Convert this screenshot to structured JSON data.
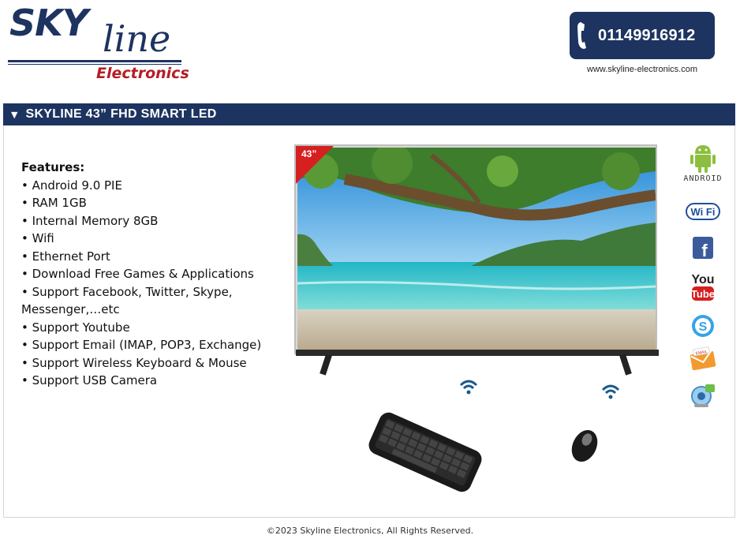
{
  "header": {
    "logo": {
      "word1": "SKY",
      "word2": "line",
      "tagline": "Electronics"
    },
    "phone": "01149916912",
    "website": "www.skyline-electronics.com"
  },
  "product": {
    "title_arrow": "▼",
    "title": "SKYLINE 43” FHD SMART LED",
    "badge": "43”",
    "features_title": "Features:",
    "features": [
      "• Android 9.0 PIE",
      "• RAM 1GB",
      "• Internal Memory 8GB",
      "• Wifi",
      "• Ethernet Port",
      "• Download Free Games & Applications",
      "• Support Facebook, Twitter, Skype, Messenger,…etc",
      "• Support Youtube",
      "• Support Email (IMAP, POP3, Exchange)",
      "• Support Wireless Keyboard & Mouse",
      "• Support USB Camera"
    ]
  },
  "side_icons": {
    "android_label": "ANDROID",
    "wifi_label": "Wi Fi",
    "facebook_label": "f",
    "youtube_top": "You",
    "youtube_bottom": "Tube",
    "skype_label": "S",
    "email_label": "EMAIL"
  },
  "icons": [
    "phone-icon",
    "android-icon",
    "wifi-icon",
    "facebook-icon",
    "youtube-icon",
    "skype-icon",
    "email-icon",
    "usb-camera-icon",
    "wireless-signal-icon",
    "keyboard-image",
    "mouse-image",
    "tv-image"
  ],
  "colors": {
    "brand_navy": "#1d3461",
    "brand_red": "#b51d25",
    "badge_red": "#d62020"
  },
  "footer": {
    "copyright": "©2023 Skyline Electronics, All Rights Reserved."
  }
}
